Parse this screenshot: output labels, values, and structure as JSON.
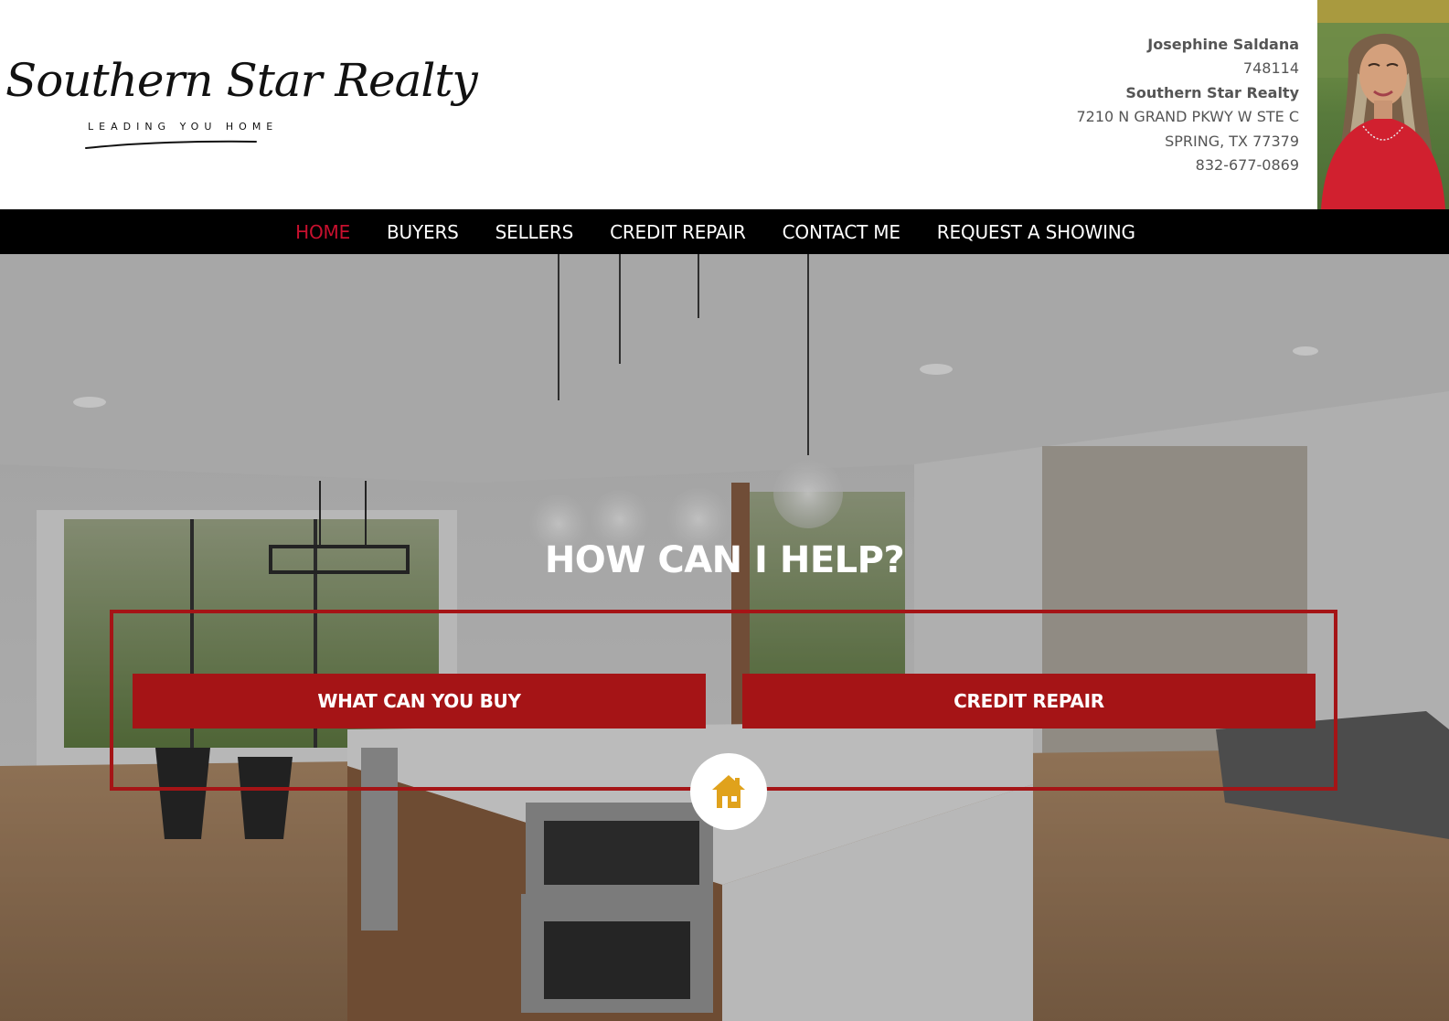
{
  "brand": {
    "logo_script": "Southern Star Realty",
    "tagline": "LEADING YOU HOME"
  },
  "agent": {
    "name": "Josephine Saldana",
    "license": "748114",
    "brokerage": "Southern Star Realty",
    "address_line1": "7210 N GRAND PKWY W STE C",
    "address_line2": "SPRING, TX 77379",
    "phone": "832-677-0869",
    "photo_icon": "agent-portrait"
  },
  "nav": {
    "items": [
      {
        "label": "HOME",
        "active": true
      },
      {
        "label": "BUYERS",
        "active": false
      },
      {
        "label": "SELLERS",
        "active": false
      },
      {
        "label": "CREDIT REPAIR",
        "active": false
      },
      {
        "label": "CONTACT ME",
        "active": false
      },
      {
        "label": "REQUEST A SHOWING",
        "active": false
      }
    ]
  },
  "hero": {
    "title": "HOW CAN I HELP?",
    "buttons": [
      {
        "label": "WHAT CAN YOU BUY"
      },
      {
        "label": "CREDIT REPAIR"
      }
    ],
    "badge_icon": "home-icon"
  },
  "colors": {
    "accent_red": "#a51416",
    "nav_active": "#c8102e",
    "nav_bg": "#000000",
    "icon_gold": "#e0a21c"
  }
}
